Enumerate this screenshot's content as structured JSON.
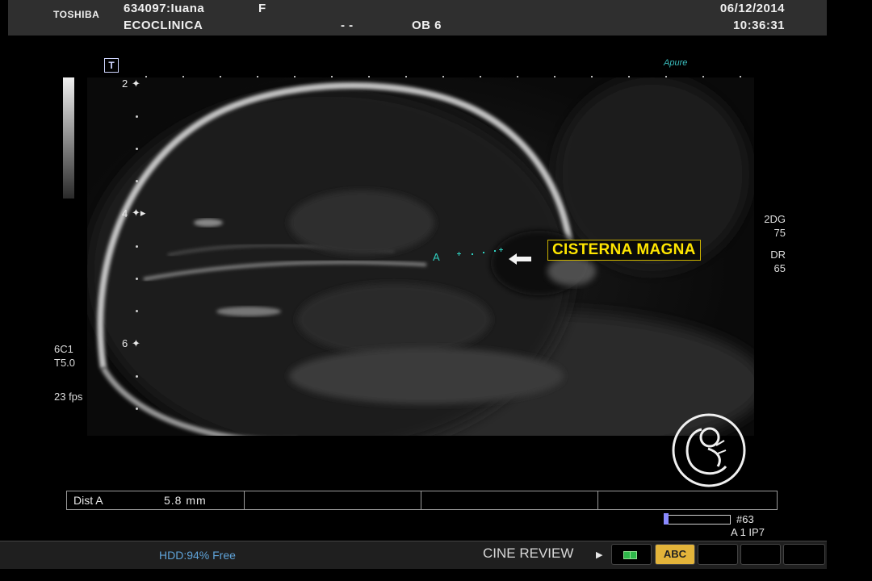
{
  "header": {
    "brand": "TOSHIBA",
    "patient": "634097:Iuana",
    "sex": "F",
    "clinic": "ECOCLINICA",
    "dashes": "- -",
    "preset": "OB 6",
    "date": "06/12/2014",
    "time": "10:36:31"
  },
  "image": {
    "orientation_marker": "T",
    "apure_logo": "Apure",
    "depth_marks": [
      "2",
      "4",
      "6"
    ],
    "annotation": "CISTERNA MAGNA",
    "caliper_label": "A"
  },
  "left_params": {
    "probe": "6C1",
    "tissue": "T5.0",
    "frame_rate": "23 fps"
  },
  "right_params": {
    "mode": "2DG",
    "gain": "75",
    "dr_label": "DR",
    "dr_value": "65"
  },
  "measurement": {
    "name": "Dist A",
    "value": "5.8  mm"
  },
  "cine": {
    "frame": "#63",
    "layer": "A 1   IP7"
  },
  "status": {
    "hdd": "HDD:94% Free",
    "cine_review": "CINE REVIEW",
    "abc": "ABC"
  },
  "colors": {
    "annotation_text": "#ffe600",
    "caliper": "#2fd0c0",
    "hdd_text": "#5fa3d8",
    "abc_button": "#e3b43a"
  }
}
